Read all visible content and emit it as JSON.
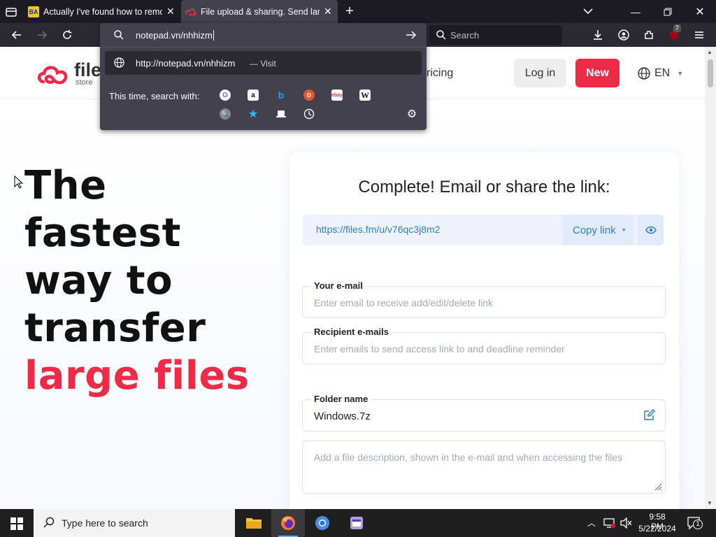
{
  "browser": {
    "tabs": [
      {
        "title": "Actually I've found how to remove",
        "favicon": "ba-favicon"
      },
      {
        "title": "File upload & sharing. Send large",
        "favicon": "filesfm-favicon",
        "active": true
      }
    ],
    "url_input": "notepad.vn/nhhizm",
    "suggestion": {
      "url": "http://notepad.vn/nhhizm",
      "action": "— Visit"
    },
    "search_with_label": "This time, search with:",
    "search_placeholder": "Search",
    "extension_badge": "7"
  },
  "site": {
    "logo_text": "file",
    "logo_sub": "store",
    "nav_pricing": "ricing",
    "login": "Log in",
    "new": "New",
    "lang": "EN",
    "brand_color": "#ee2b47"
  },
  "hero": {
    "line1": "The fastest",
    "line2": "way to",
    "line3": "transfer",
    "line4": "large files"
  },
  "card": {
    "title": "Complete! Email or share the link:",
    "link": "https://files.fm/u/v76qc3j8m2",
    "copy_link": "Copy link",
    "email_label": "Your e-mail",
    "email_placeholder": "Enter email to receive add/edit/delete link",
    "recipients_label": "Recipient e-mails",
    "recipients_placeholder": "Enter emails to send access link to and deadline reminder",
    "folder_label": "Folder name",
    "folder_value": "Windows.7z",
    "description_placeholder": "Add a file description, shown in the e-mail and when accessing the files"
  },
  "taskbar": {
    "search": "Type here to search",
    "time": "9:58 PM",
    "date": "5/22/2024",
    "notification_count": "1"
  }
}
